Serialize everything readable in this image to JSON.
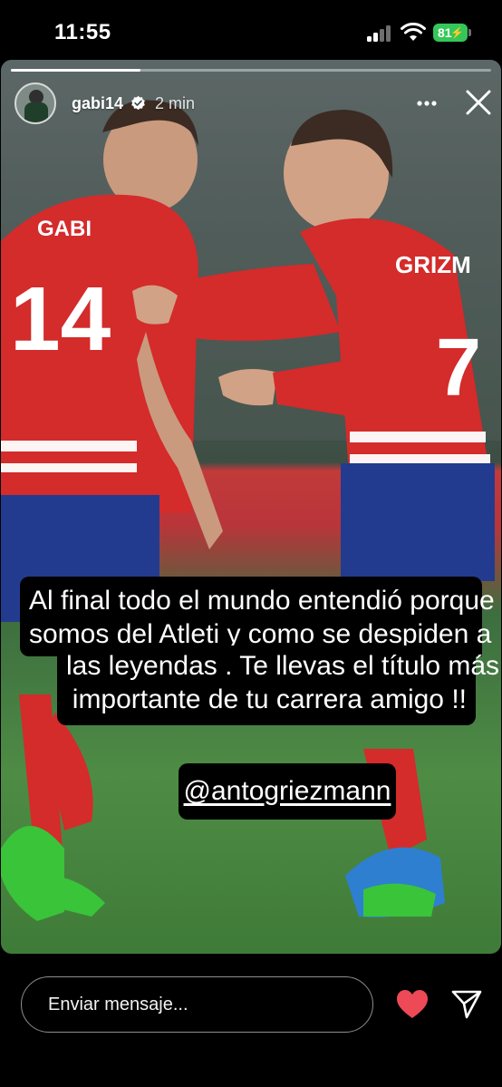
{
  "status_bar": {
    "time": "11:55",
    "battery": "81",
    "icons": [
      "signal-icon",
      "wifi-icon",
      "battery-icon"
    ]
  },
  "story": {
    "progress": 0.27,
    "username": "gabi14",
    "verified": true,
    "time_ago": "2 min",
    "jersey_names": [
      "GABI",
      "GRIZM"
    ],
    "jersey_numbers": [
      "14",
      "7"
    ],
    "caption_lines": [
      "Al final todo el mundo entendió porque",
      "somos del Atleti y como se despiden a",
      "las leyendas . Te llevas el  título más",
      "importante  de tu carrera amigo !!"
    ],
    "mention": "@antogriezmann"
  },
  "reply_bar": {
    "placeholder": "Enviar mensaje...",
    "heart_color": "#ed4956"
  },
  "icons": {
    "more": "more-horizontal-icon",
    "close": "close-icon",
    "verified": "verified-badge-icon",
    "heart": "heart-icon",
    "send": "send-icon"
  }
}
